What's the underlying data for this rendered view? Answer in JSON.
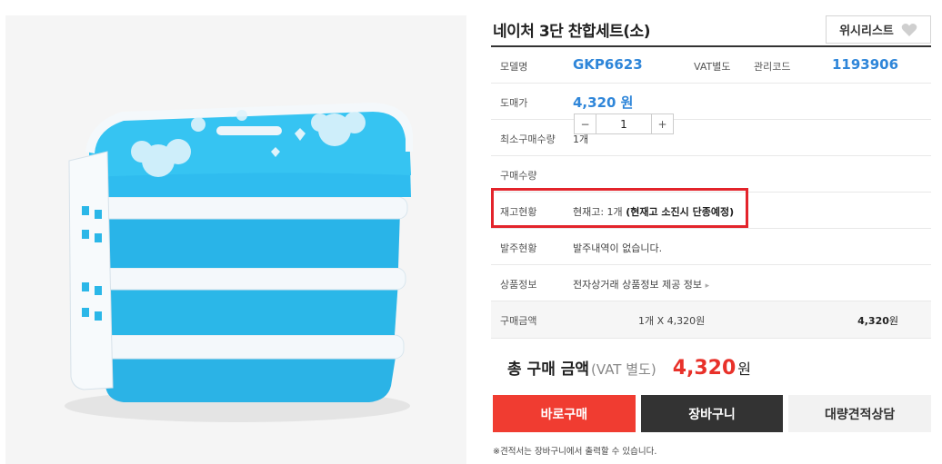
{
  "product": {
    "title": "네이처 3단 찬합세트(소)",
    "wishlist_label": "위시리스트",
    "image_alt": "blue 3-tier lunch box"
  },
  "spec": {
    "model_label": "모델명",
    "model_value": "GKP6623",
    "vat_label": "VAT별도",
    "mgmt_label": "관리코드",
    "mgmt_value": "1193906",
    "price_label": "도매가",
    "price_value": "4,320 원",
    "minqty_label": "최소구매수량",
    "minqty_value": "1개",
    "qty_label": "구매수량",
    "qty_minus": "−",
    "qty_value": "1",
    "qty_plus": "+",
    "stock_label": "재고현황",
    "stock_value": "현재고: 1개",
    "stock_note": "(현재고 소진시 단종예정)",
    "order_label": "발주현황",
    "order_value": "발주내역이 없습니다.",
    "info_label": "상품정보",
    "info_value": "전자상거래 상품정보 제공 정보",
    "amount_label": "구매금액",
    "amount_calc": "1개 X 4,320원",
    "amount_total": "4,320",
    "amount_unit": "원"
  },
  "total": {
    "label": "총 구매 금액",
    "vat": "(VAT 별도)",
    "price": "4,320",
    "unit": "원"
  },
  "actions": {
    "buy": "바로구매",
    "cart": "장바구니",
    "quote": "대량견적상담"
  },
  "note": "※견적서는 장바구니에서 출력할 수 있습니다.",
  "colors": {
    "accent_blue": "#2f86d9",
    "buy_red": "#f03c31",
    "price_red": "#e8312a",
    "highlight_red": "#e3242b",
    "product_blue": "#2bb7e8"
  }
}
